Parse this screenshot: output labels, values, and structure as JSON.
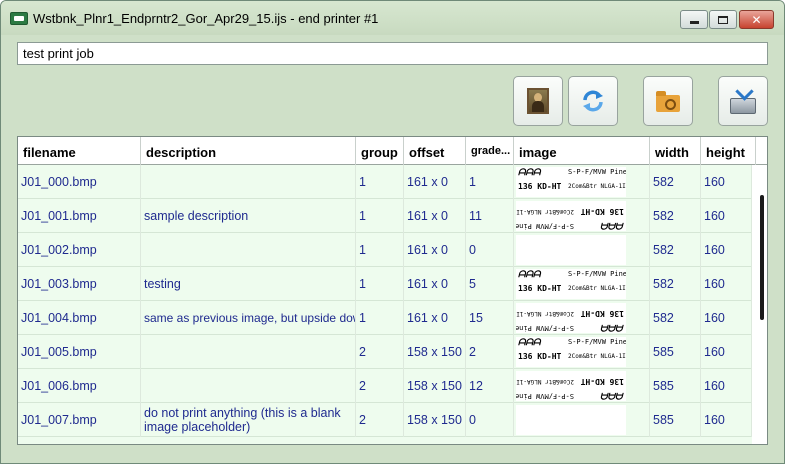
{
  "window": {
    "title": "Wstbnk_Plnr1_Endprntr2_Gor_Apr29_15.ijs - end printer #1",
    "close_label": "✕"
  },
  "job_field": {
    "value": "test print job"
  },
  "toolbar": {
    "buttons": [
      {
        "name": "image-button",
        "icon": "portrait-icon"
      },
      {
        "name": "refresh-button",
        "icon": "refresh-icon"
      },
      {
        "name": "open-folder-button",
        "icon": "folder-search-icon"
      },
      {
        "name": "save-button",
        "icon": "save-download-icon"
      }
    ]
  },
  "table": {
    "columns": [
      "filename",
      "description",
      "group",
      "offset",
      "grade...",
      "image",
      "width",
      "height"
    ],
    "rows": [
      {
        "filename": "J01_000.bmp",
        "description": "",
        "group": "1",
        "offset": "161 x 0",
        "grade": "1",
        "image": "normal",
        "width": "582",
        "height": "160"
      },
      {
        "filename": "J01_001.bmp",
        "description": "sample description",
        "group": "1",
        "offset": "161 x 0",
        "grade": "11",
        "image": "flipped",
        "width": "582",
        "height": "160"
      },
      {
        "filename": "J01_002.bmp",
        "description": "",
        "group": "1",
        "offset": "161 x 0",
        "grade": "0",
        "image": "blank",
        "width": "582",
        "height": "160"
      },
      {
        "filename": "J01_003.bmp",
        "description": "testing",
        "group": "1",
        "offset": "161 x 0",
        "grade": "5",
        "image": "normal",
        "width": "582",
        "height": "160"
      },
      {
        "filename": "J01_004.bmp",
        "description": "same as previous image, but upside down",
        "group": "1",
        "offset": "161 x 0",
        "grade": "15",
        "image": "flipped",
        "width": "582",
        "height": "160"
      },
      {
        "filename": "J01_005.bmp",
        "description": "",
        "group": "2",
        "offset": "158 x 150",
        "grade": "2",
        "image": "normal",
        "width": "585",
        "height": "160"
      },
      {
        "filename": "J01_006.bmp",
        "description": "",
        "group": "2",
        "offset": "158 x 150",
        "grade": "12",
        "image": "flipped",
        "width": "585",
        "height": "160"
      },
      {
        "filename": "J01_007.bmp",
        "description": "do not print anything (this is a blank image placeholder)",
        "group": "2",
        "offset": "158 x 150",
        "grade": "0",
        "image": "blank",
        "width": "585",
        "height": "160"
      }
    ],
    "thumb_text": {
      "logo": "ᗩᗩᗩ",
      "line1": "S-P-F/MVW Pine",
      "line2": "136 KD-HT",
      "line3": "2Com&Btr NLGA-1IS"
    }
  },
  "colors": {
    "window_bg": "#cfe0c8",
    "row_bg": "#eefcee",
    "cell_text": "#1f2a8f"
  }
}
